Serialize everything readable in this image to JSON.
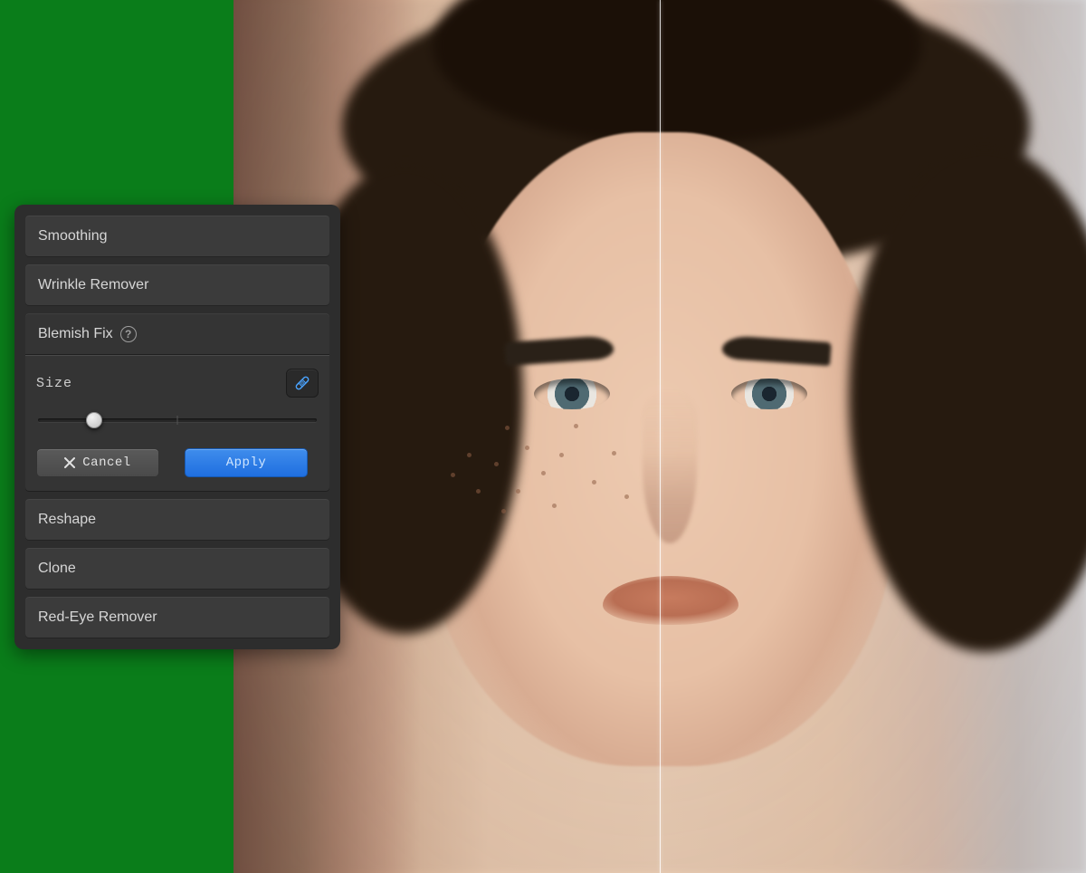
{
  "panel": {
    "tools": {
      "smoothing": {
        "label": "Smoothing"
      },
      "wrinkle_remover": {
        "label": "Wrinkle Remover"
      },
      "blemish_fix": {
        "label": "Blemish Fix"
      },
      "reshape": {
        "label": "Reshape"
      },
      "clone": {
        "label": "Clone"
      },
      "red_eye_remover": {
        "label": "Red-Eye Remover"
      }
    },
    "blemish_fix": {
      "size_label": "Size",
      "slider_percent": 20,
      "brush_icon": "bandaid-icon",
      "cancel_label": "Cancel",
      "apply_label": "Apply"
    }
  },
  "colors": {
    "page_bg": "#0a7d1a",
    "panel_bg": "#2d2d2d",
    "accent_blue": "#2a78e4"
  }
}
